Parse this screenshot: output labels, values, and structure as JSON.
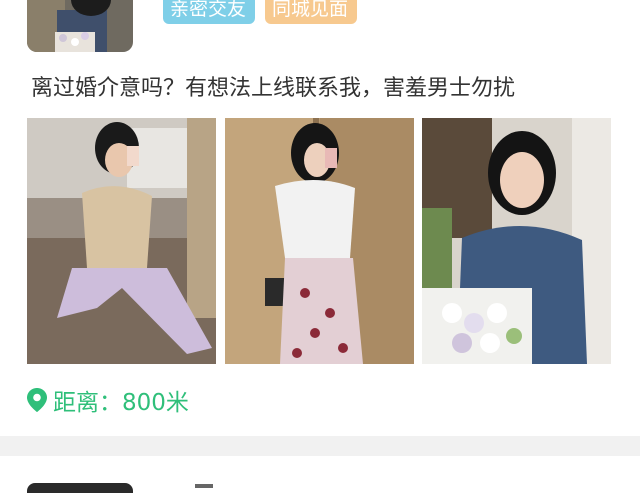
{
  "post": {
    "tags": [
      "亲密交友",
      "同城见面"
    ],
    "description": "离过婚介意吗？有想法上线联系我，害羞男士勿扰",
    "distance_label": "距离：800米",
    "photos": [
      "photo-1",
      "photo-2",
      "photo-3"
    ]
  },
  "colors": {
    "accent_green": "#2fbf7a",
    "tag_blue": "#7fcfe8",
    "tag_orange": "#f7c98f"
  }
}
